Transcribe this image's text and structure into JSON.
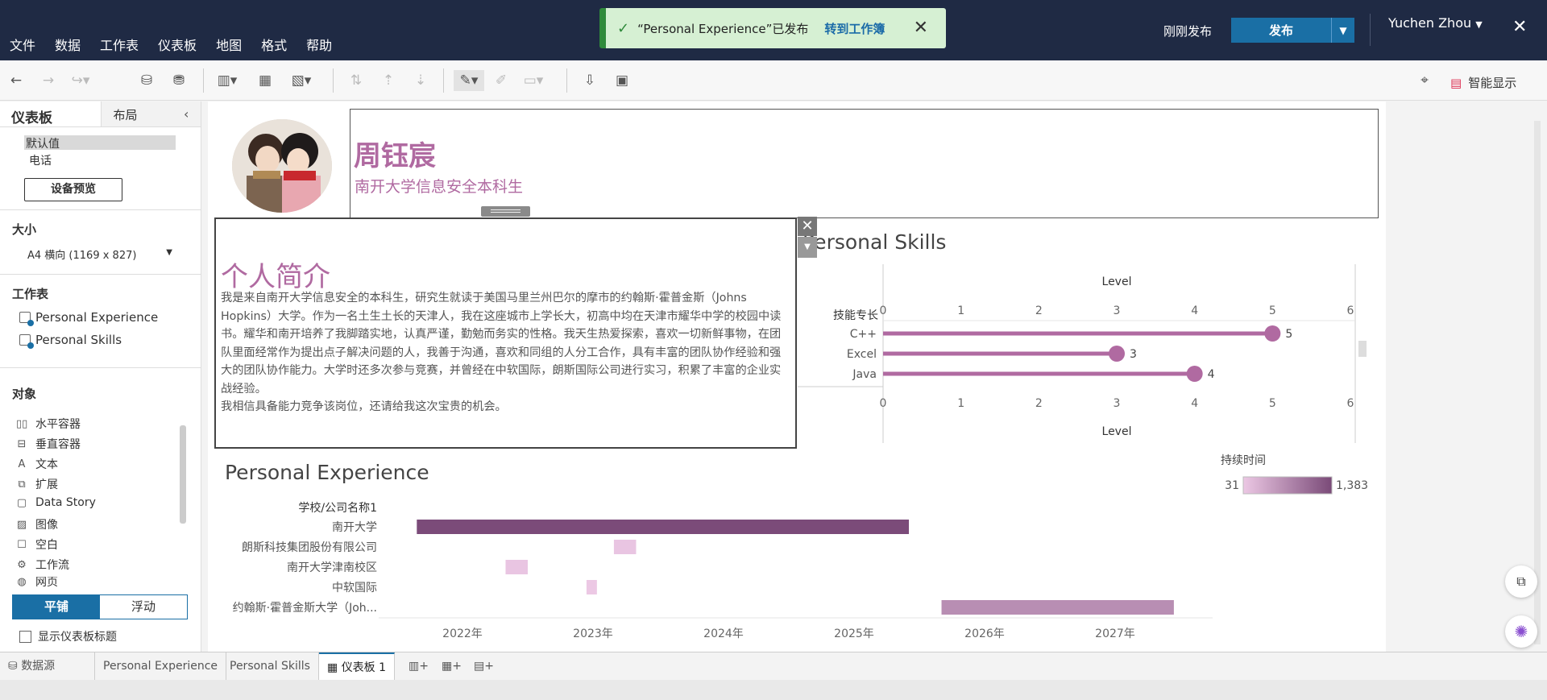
{
  "menu": [
    "文件",
    "数据",
    "工作表",
    "仪表板",
    "地图",
    "格式",
    "帮助"
  ],
  "toast": {
    "message": "“Personal Experience”已发布",
    "link": "转到工作簿"
  },
  "header": {
    "publish_status": "刚刚发布",
    "publish_button": "发布",
    "user": "Yuchen Zhou"
  },
  "toolbar": {
    "smart_show": "智能显示"
  },
  "left_panel": {
    "tab_dashboard": "仪表板",
    "tab_layout": "布局",
    "devices": [
      "默认值",
      "电话"
    ],
    "device_preview": "设备预览",
    "size_heading": "大小",
    "size_value": "A4 横向 (1169 x 827)",
    "sheets_heading": "工作表",
    "sheets": [
      "Personal Experience",
      "Personal Skills"
    ],
    "objects_heading": "对象",
    "objects": [
      "水平容器",
      "垂直容器",
      "文本",
      "扩展",
      "Data Story",
      "图像",
      "空白",
      "工作流",
      "网页"
    ],
    "tiled": "平铺",
    "floating": "浮动",
    "show_title": "显示仪表板标题"
  },
  "dashboard": {
    "name": "周钰宸",
    "school": "南开大学信息安全本科生",
    "intro_title": "个人简介",
    "intro_paragraph_1": "我是来自南开大学信息安全的本科生，研究生就读于美国马里兰州巴尔的摩市的约翰斯·霍普金斯（Johns Hopkins）大学。作为一名土生土长的天津人，我在这座城市上学长大，初高中均在天津市耀华中学的校园中读书。耀华和南开培养了我脚踏实地，认真严谨，勤勉而务实的性格。我天生热爱探索，喜欢一切新鲜事物，在团队里面经常作为提出点子解决问题的人，我善于沟通，喜欢和同组的人分工合作，具有丰富的团队协作经验和强大的团队协作能力。大学时还多次参与竞赛，并曾经在中软国际，朗斯国际公司进行实习，积累了丰富的企业实战经验。",
    "intro_paragraph_2": "我相信具备能力竞争该岗位，还请给我这次宝贵的机会。",
    "skills_title": "Personal Skills",
    "experience_title": "Personal Experience"
  },
  "chart_data": [
    {
      "type": "scatter",
      "title": "Personal Skills",
      "row_header": "技能专长",
      "xlabel": "Level",
      "xlim": [
        0,
        6
      ],
      "x_ticks": [
        0,
        1,
        2,
        3,
        4,
        5,
        6
      ],
      "categories": [
        "C++",
        "Excel",
        "Java"
      ],
      "values": [
        5,
        3,
        4
      ],
      "color": "#b06aa1"
    },
    {
      "type": "bar",
      "title": "Personal Experience",
      "row_header": "学校/公司名称1",
      "x_ticks": [
        "2022年",
        "2023年",
        "2024年",
        "2025年",
        "2026年",
        "2027年"
      ],
      "categories": [
        "南开大学",
        "朗斯科技集团股份有限公司",
        "南开大学津南校区",
        "中软国际",
        "约翰斯·霍普金斯大学（Joh..."
      ],
      "start": [
        2021.65,
        2023.16,
        2022.33,
        2022.95,
        2025.67
      ],
      "end": [
        2025.42,
        2023.33,
        2022.5,
        2023.03,
        2027.45
      ],
      "legend_title": "持续时间",
      "legend_min": "31",
      "legend_max": "1,383",
      "color_range": [
        "#ecc8e4",
        "#7a4a78"
      ]
    }
  ],
  "bottom_tabs": [
    "数据源",
    "Personal Experience",
    "Personal Skills",
    "仪表板 1"
  ]
}
